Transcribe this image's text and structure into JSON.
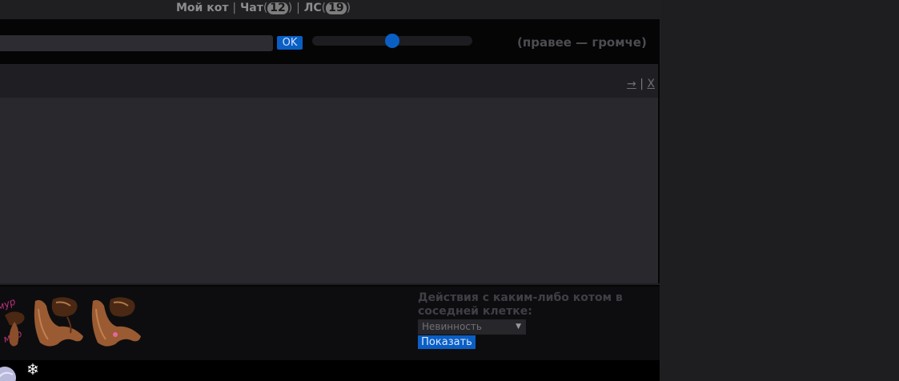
{
  "topnav": {
    "my_cat": "Мой кот",
    "sep1": "|",
    "chat": "Чат",
    "chat_count": "12",
    "sep2": "|",
    "pm": "ЛС",
    "pm_count": "19"
  },
  "chat_input": {
    "value": "",
    "ok_label": "OK",
    "volume_level": 0.5,
    "volume_hint": "(правее — громче)"
  },
  "chat_controls": {
    "arrow": "→",
    "sep": "|",
    "close": "X"
  },
  "actions": {
    "title": "Действия с каким-либо котом в соседней клетке:",
    "selected": "Невинность",
    "show_label": "Показать"
  },
  "footer": {
    "snowflake": "❄"
  },
  "colors": {
    "accent": "#0a5fc4",
    "bg": "#1f1f22"
  }
}
